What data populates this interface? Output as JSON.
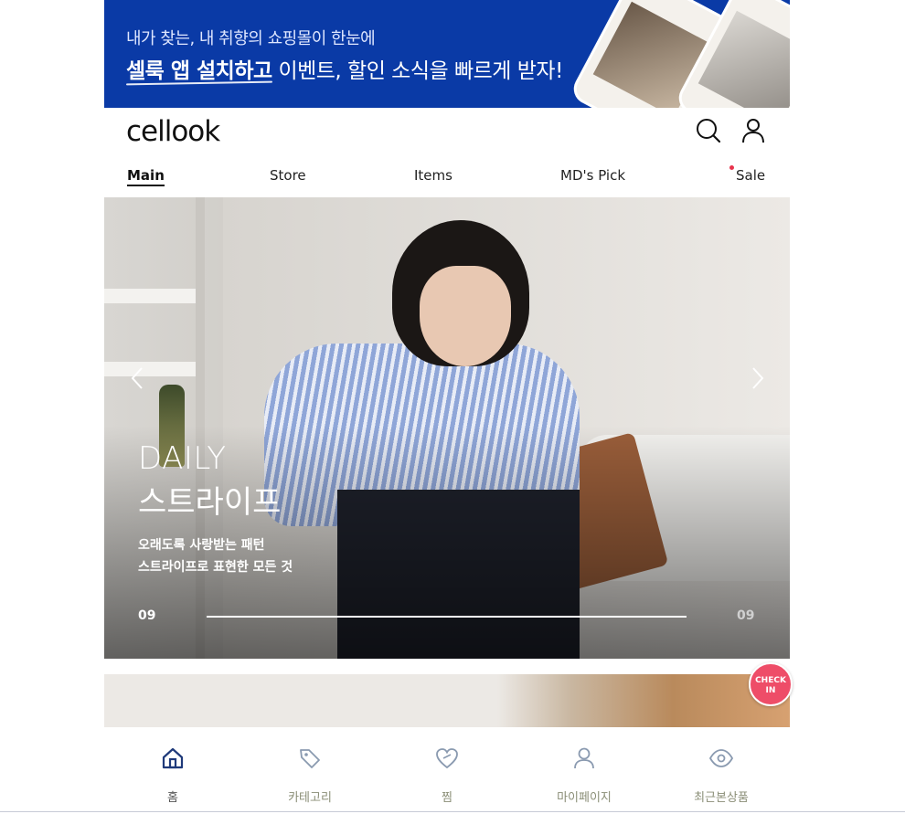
{
  "promo": {
    "line1": "내가 찾는, 내 취향의 쇼핑몰이 한눈에",
    "line2_bold": "셀룩 앱 설치하고",
    "line2_rest": " 이벤트, 할인 소식을  빠르게 받자!"
  },
  "header": {
    "logo": "cellook",
    "search_icon": "search-icon",
    "account_icon": "user-icon"
  },
  "nav": {
    "items": [
      {
        "label": "Main",
        "active": true
      },
      {
        "label": "Store",
        "active": false
      },
      {
        "label": "Items",
        "active": false
      },
      {
        "label": "MD's Pick",
        "active": false
      },
      {
        "label": "Sale",
        "active": false,
        "dot_color": "#e8344d"
      }
    ]
  },
  "hero": {
    "title_line1": "DAILY",
    "title_line2": "스트라이프",
    "subtitle_line1": "오래도록 사랑받는 패턴",
    "subtitle_line2": "스트라이프로 표현한 모든 것",
    "page_current": "09",
    "page_total": "09",
    "progress": 1.0
  },
  "checkin": {
    "line1": "CHECK",
    "line2": "IN",
    "color": "#ee4d68"
  },
  "tabbar": {
    "items": [
      {
        "label": "홈",
        "icon": "home-icon",
        "active": true
      },
      {
        "label": "카테고리",
        "icon": "tag-icon",
        "active": false
      },
      {
        "label": "찜",
        "icon": "heart-icon",
        "active": false
      },
      {
        "label": "마이페이지",
        "icon": "user-icon",
        "active": false
      },
      {
        "label": "최근본상품",
        "icon": "eye-icon",
        "active": false
      }
    ]
  },
  "colors": {
    "brand_blue": "#0a3aa6",
    "active_icon": "#1f3a7a",
    "inactive_icon": "#8a9ab0"
  }
}
